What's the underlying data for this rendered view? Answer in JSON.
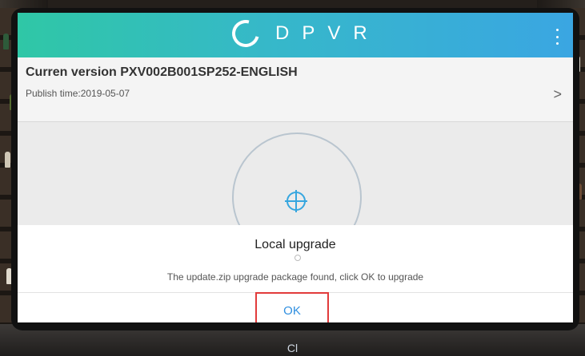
{
  "header": {
    "brand": "DPVR"
  },
  "version": {
    "title": "Curren version PXV002B001SP252-ENGLISH",
    "publish": "Publish time:2019-05-07"
  },
  "dialog": {
    "title": "Local upgrade",
    "message": "The update.zip upgrade package found, click OK to upgrade",
    "ok": "OK"
  },
  "floor_caption": "Cl",
  "colors": {
    "header_start": "#2fc7a6",
    "header_end": "#3aa6e2",
    "accent": "#36a6df",
    "highlight_box": "#e23b3b"
  },
  "icons": [
    "logo-ring-icon",
    "more-vert-icon",
    "chevron-right-icon",
    "crosshair-icon"
  ]
}
